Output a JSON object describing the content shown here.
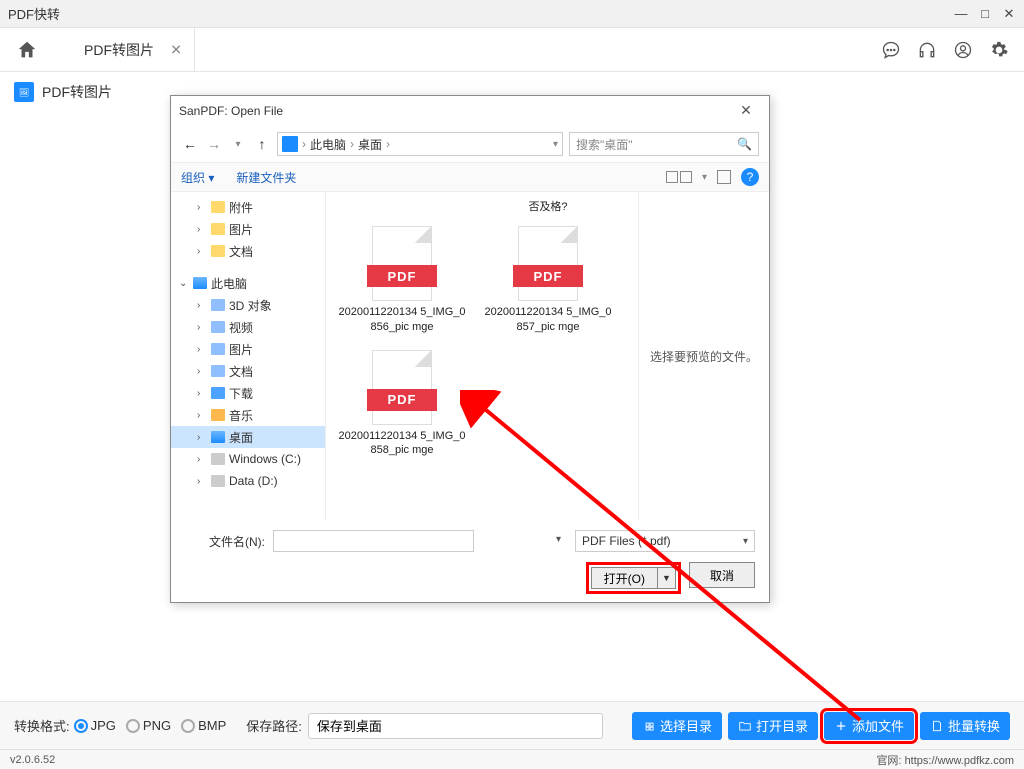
{
  "app": {
    "title": "PDF快转"
  },
  "win_controls": {
    "min": "—",
    "max": "□",
    "close": "✕"
  },
  "tab": {
    "label": "PDF转图片",
    "close": "✕"
  },
  "sidebar": {
    "item_label": "PDF转图片"
  },
  "bottom": {
    "format_label": "转换格式:",
    "radios": {
      "jpg": "JPG",
      "png": "PNG",
      "bmp": "BMP"
    },
    "save_label": "保存路径:",
    "save_value": "保存到桌面",
    "btn_choose_dir": "选择目录",
    "btn_open_dir": "打开目录",
    "btn_add_file": "添加文件",
    "btn_batch": "批量转换"
  },
  "status": {
    "version": "v2.0.6.52",
    "site_label": "官网:",
    "site_url": "https://www.pdfkz.com"
  },
  "dialog": {
    "title": "SanPDF: Open File",
    "close": "✕",
    "breadcrumb": {
      "root": "此电脑",
      "folder": "桌面",
      "sep": "›"
    },
    "search_placeholder": "搜索\"桌面\"",
    "toolbar": {
      "organize": "组织 ▾",
      "new_folder": "新建文件夹"
    },
    "tree": {
      "attachments": "附件",
      "pictures1": "图片",
      "docs1": "文档",
      "this_pc": "此电脑",
      "objects_3d": "3D 对象",
      "videos": "视频",
      "pictures2": "图片",
      "docs2": "文档",
      "downloads": "下载",
      "music": "音乐",
      "desktop": "桌面",
      "win_c": "Windows (C:)",
      "data_d": "Data (D:)"
    },
    "truncated_text": "否及格?",
    "files": [
      {
        "name": "2020011220134\n5_IMG_0856_pic\nmge"
      },
      {
        "name": "2020011220134\n5_IMG_0857_pic\nmge"
      },
      {
        "name": "2020011220134\n5_IMG_0858_pic\nmge"
      }
    ],
    "pdf_band": "PDF",
    "preview_hint": "选择要预览的文件。",
    "filename_label": "文件名(N):",
    "filter_label": "PDF Files (*.pdf)",
    "open_btn": "打开(O)",
    "cancel_btn": "取消"
  }
}
